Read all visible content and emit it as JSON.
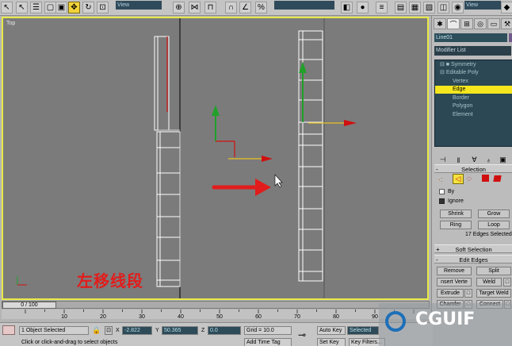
{
  "toolbar": {
    "view_dropdown_1": "View",
    "view_dropdown_2": "View",
    "selection_set_dropdown": ""
  },
  "viewport": {
    "label": "Top",
    "caption": "左移线段"
  },
  "panel": {
    "object_name": "Line01",
    "modifier_list": "Modifier List",
    "stack": [
      {
        "label": "Symmetry",
        "selected": false
      },
      {
        "label": "Editable Poly",
        "selected": false
      },
      {
        "label": "Vertex",
        "selected": false
      },
      {
        "label": "Edge",
        "selected": true
      },
      {
        "label": "Border",
        "selected": false
      },
      {
        "label": "Polygon",
        "selected": false
      },
      {
        "label": "Element",
        "selected": false
      }
    ],
    "selection": {
      "title": "Selection",
      "by_label": "By",
      "ignore_label": "Ignore",
      "shrink": "Shrink",
      "grow": "Grow",
      "ring": "Ring",
      "loop": "Loop",
      "status": "17 Edges Selected"
    },
    "soft_selection": {
      "title": "Soft Selection"
    },
    "edit_edges": {
      "title": "Edit Edges",
      "remove": "Remove",
      "split": "Split",
      "insert_vertex": "nsert Verte",
      "weld": "Weld",
      "extrude": "Extrude",
      "target_weld": "Target Weld",
      "chamfer": "Chamfer",
      "connect": "Connect"
    }
  },
  "timeline": {
    "frame_display": "0 / 100",
    "current_frame": 0,
    "total_frames": 100,
    "ticks": [
      "10",
      "20",
      "30",
      "40",
      "50",
      "60",
      "70",
      "80",
      "90"
    ]
  },
  "status": {
    "selection_count": "1 Object Selected",
    "prompt": "Click or click-and-drag to select objects",
    "x_label": "X",
    "x_value": "-2.822",
    "y_label": "Y",
    "y_value": "50.365",
    "z_label": "Z",
    "z_value": "0.0",
    "grid": "Grid = 10.0",
    "add_time_tag": "Add Time Tag",
    "auto_key": "Auto Key",
    "set_key": "Set Key",
    "selected_dropdown": "Selected",
    "key_filters": "Key Filters..."
  },
  "watermark": {
    "brand": "CGUIF"
  },
  "colors": {
    "viewport_bg": "#7b7b7b",
    "viewport_border": "#e8e848",
    "stack_bg": "#2b4854",
    "stack_selected": "#f6e61e",
    "caption": "#e21c1c",
    "arrow": "#e21c1c"
  }
}
